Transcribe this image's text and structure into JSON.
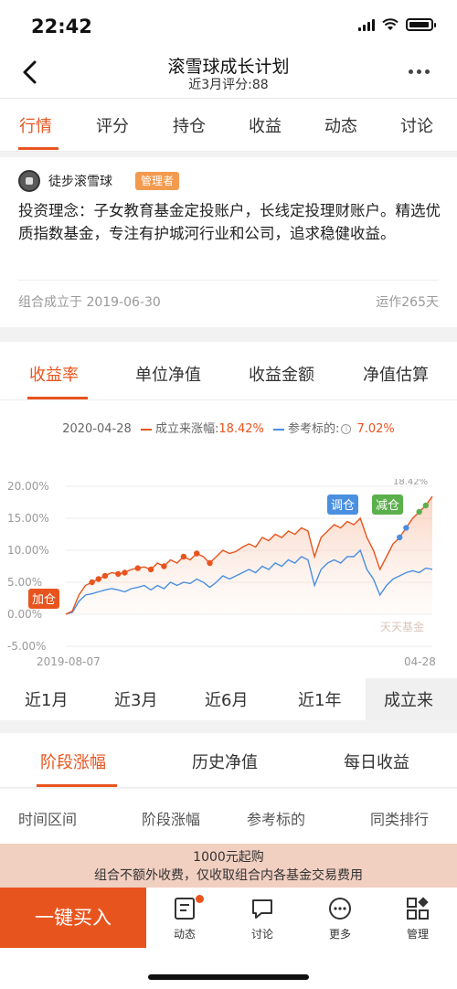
{
  "status": {
    "time": "22:42"
  },
  "nav": {
    "title": "滚雪球成长计划",
    "subtitle": "近3月评分:88"
  },
  "top_tabs": [
    "行情",
    "评分",
    "持仓",
    "收益",
    "动态",
    "讨论"
  ],
  "info": {
    "author": "徒步滚雪球",
    "badge": "管理者",
    "philosophy": "投资理念：子女教育基金定投账户，长线定投理财账户。精选优质指数基金，专注有护城河行业和公司，追求稳健收益。",
    "founded": "组合成立于 2019-06-30",
    "running": "运作265天"
  },
  "chart_tabs": [
    "收益率",
    "单位净值",
    "收益金额",
    "净值估算"
  ],
  "legend": {
    "date": "2020-04-28",
    "series1_label": "成立来涨幅:",
    "series1_value": "18.42%",
    "series2_label": "参考标的:",
    "series2_value": "7.02%",
    "colors": {
      "portfolio": "#e8541e",
      "benchmark": "#4a8fe0"
    }
  },
  "chart_data": {
    "type": "line",
    "x_start": "2019-08-07",
    "x_end": "04-28",
    "ylim": [
      -5,
      20
    ],
    "yticks": [
      "20.00%",
      "15.00%",
      "10.00%",
      "5.00%",
      "0.00%",
      "-5.00%"
    ],
    "peak_label": "18.42%",
    "watermark": "天天基金",
    "annotations": {
      "add": "加仓",
      "adjust": "调仓",
      "reduce": "减仓"
    },
    "series": [
      {
        "name": "成立来涨幅",
        "values": [
          0,
          0.5,
          3,
          4.5,
          5,
          5.5,
          6,
          6.5,
          6.3,
          6.5,
          7,
          7.2,
          7.4,
          7,
          8,
          7.5,
          8.5,
          8,
          9,
          8.5,
          9.5,
          9,
          8,
          9,
          10,
          9.5,
          9.8,
          10.5,
          11,
          10.5,
          12,
          11.5,
          12.5,
          12,
          13,
          12.5,
          13.5,
          13,
          9,
          12,
          13,
          14,
          13.5,
          14.5,
          14,
          15,
          12,
          10,
          7,
          9,
          11,
          12,
          13.5,
          15,
          16,
          17,
          18.42
        ]
      },
      {
        "name": "参考标的",
        "values": [
          0,
          0.3,
          2,
          3,
          3.2,
          3.5,
          3.8,
          4,
          3.8,
          3.5,
          4,
          4.2,
          4.5,
          3.8,
          4.5,
          4,
          5,
          4.5,
          5,
          4.8,
          5.5,
          5,
          4.2,
          5,
          6,
          5.5,
          6,
          6.5,
          7,
          6.5,
          7.5,
          7,
          8,
          7.5,
          8.5,
          8,
          9,
          8.5,
          4.5,
          7,
          8,
          8.5,
          8,
          9,
          9,
          10,
          7,
          5.5,
          3,
          4.5,
          5.5,
          6,
          6.5,
          6.8,
          6.5,
          7.2,
          7.02
        ]
      }
    ]
  },
  "periods": [
    "近1月",
    "近3月",
    "近6月",
    "近1年",
    "成立来"
  ],
  "sections": [
    "阶段涨幅",
    "历史净值",
    "每日收益"
  ],
  "table_headers": [
    "时间区间",
    "阶段涨幅",
    "参考标的",
    "同类排行"
  ],
  "promo": {
    "line1": "1000元起购",
    "line2": "组合不额外收费，仅收取组合内各基金交易费用"
  },
  "bottom": {
    "buy": "一键买入",
    "items": [
      "动态",
      "讨论",
      "更多",
      "管理"
    ]
  }
}
